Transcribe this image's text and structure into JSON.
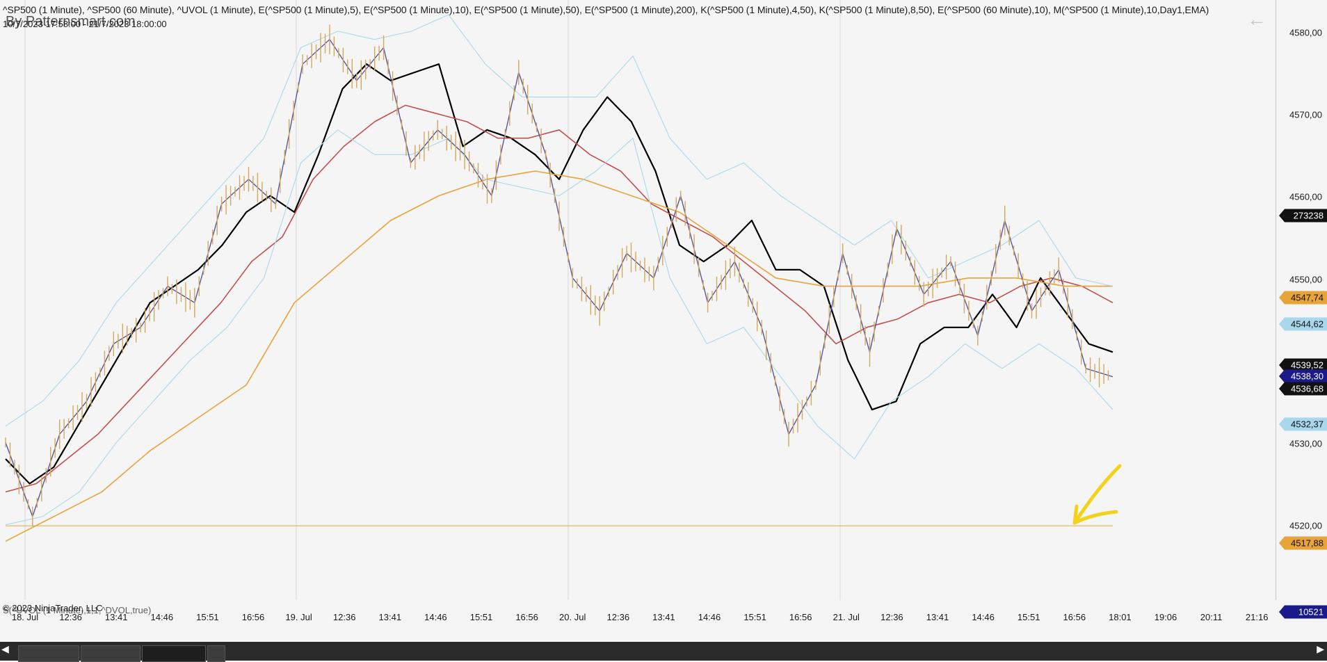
{
  "header": {
    "title": "^SP500 (1 Minute), ^SP500 (60 Minute), ^UVOL (1 Minute), E(^SP500 (1 Minute),5), E(^SP500 (1 Minute),10), E(^SP500 (1 Minute),50), E(^SP500 (1 Minute),200), K(^SP500 (1 Minute),4,50), K(^SP500 (1 Minute),8,50), E(^SP500 (60 Minute),10), M(^SP500 (1 Minute),10,Day1,EMA)",
    "subtitle": "10/7/2023 17:58:00 - 21/7/2023 18:00:00",
    "brand": "By Patternsmart.com"
  },
  "lower_panel": {
    "indicator": "S(^UVOL (1 Minute),1,1,^DVOL,true)",
    "copyright": "© 2023 NinjaTrader, LLC"
  },
  "price_axis": {
    "labels": [
      "4580,00",
      "4570,00",
      "4560,00",
      "4550,00",
      "4540,00",
      "4530,00",
      "4520,00"
    ],
    "tags": [
      {
        "value": "273238",
        "bg": "#111111",
        "fg": "#ffffff"
      },
      {
        "value": "4547,74",
        "bg": "#e8a33a",
        "fg": "#111111"
      },
      {
        "value": "4544,62",
        "bg": "#a9d8ec",
        "fg": "#111111"
      },
      {
        "value": "4539,52",
        "bg": "#111111",
        "fg": "#ffffff"
      },
      {
        "value": "4538,30",
        "bg": "#1a1a8a",
        "fg": "#ffffff"
      },
      {
        "value": "4536,68",
        "bg": "#111111",
        "fg": "#ffffff"
      },
      {
        "value": "4532,37",
        "bg": "#a9d8ec",
        "fg": "#111111"
      },
      {
        "value": "4517,88",
        "bg": "#e8a33a",
        "fg": "#111111"
      },
      {
        "value": "10521",
        "bg": "#1a1a8a",
        "fg": "#ffffff"
      }
    ]
  },
  "time_axis": {
    "labels": [
      "18. Jul",
      "12:36",
      "13:41",
      "14:46",
      "15:51",
      "16:56",
      "19. Jul",
      "12:36",
      "13:41",
      "14:46",
      "15:51",
      "16:56",
      "20. Jul",
      "12:36",
      "13:41",
      "14:46",
      "15:51",
      "16:56",
      "21. Jul",
      "12:36",
      "13:41",
      "14:46",
      "15:51",
      "16:56",
      "18:01",
      "19:06",
      "20:11",
      "21:16"
    ]
  },
  "chart_data": {
    "type": "line",
    "symbol": "^SP500",
    "y_range": [
      4512,
      4584
    ],
    "day_separators": [
      "18. Jul",
      "19. Jul",
      "20. Jul",
      "21. Jul"
    ],
    "series": [
      {
        "name": "E(^SP500 (1 Minute),10)",
        "color": "#000000",
        "values": [
          4526,
          4523,
          4525,
          4530,
          4535,
          4540,
          4545,
          4547,
          4549,
          4552,
          4556,
          4558,
          4556,
          4563,
          4571,
          4574,
          4572,
          4573,
          4574,
          4564,
          4566,
          4565,
          4563,
          4560,
          4566,
          4570,
          4567,
          4561,
          4552,
          4550,
          4552,
          4555,
          4549,
          4549,
          4547,
          4538,
          4532,
          4533,
          4540,
          4542,
          4542,
          4546,
          4542,
          4548,
          4544,
          4540,
          4539
        ]
      },
      {
        "name": "E(^SP500 (1 Minute),50)",
        "color": "#c0504d",
        "values": [
          4522,
          4523,
          4526,
          4529,
          4533,
          4537,
          4541,
          4545,
          4550,
          4553,
          4560,
          4564,
          4567,
          4569,
          4568,
          4567,
          4565,
          4565,
          4566,
          4563,
          4561,
          4557,
          4555,
          4553,
          4550,
          4547,
          4544,
          4540,
          4542,
          4543,
          4545,
          4546,
          4545,
          4547,
          4548,
          4547,
          4545
        ]
      },
      {
        "name": "E(^SP500 (1 Minute),200)",
        "color": "#e8a33a",
        "values": [
          4516,
          4519,
          4522,
          4527,
          4531,
          4535,
          4545,
          4550,
          4555,
          4558,
          4560,
          4561,
          4560,
          4558,
          4556,
          4552,
          4548,
          4547,
          4547,
          4547,
          4548,
          4548,
          4547,
          4547
        ]
      },
      {
        "name": "K upper",
        "color": "#a9d8ec",
        "values": [
          4530,
          4533,
          4538,
          4545,
          4550,
          4555,
          4560,
          4565,
          4576,
          4578,
          4577,
          4578,
          4580,
          4574,
          4570,
          4570,
          4570,
          4575,
          4565,
          4560,
          4562,
          4558,
          4555,
          4552,
          4555,
          4548,
          4550,
          4552,
          4555,
          4548,
          4547
        ]
      },
      {
        "name": "K lower",
        "color": "#a9d8ec",
        "values": [
          4518,
          4519,
          4522,
          4528,
          4533,
          4538,
          4542,
          4548,
          4562,
          4566,
          4563,
          4563,
          4565,
          4560,
          4559,
          4558,
          4561,
          4565,
          4548,
          4540,
          4542,
          4536,
          4530,
          4526,
          4533,
          4536,
          4540,
          4537,
          4540,
          4537,
          4532
        ]
      },
      {
        "name": "^SP500 (1 Minute)",
        "color": "#4b4ba0",
        "values": [
          4528,
          4519,
          4529,
          4533,
          4540,
          4542,
          4547,
          4545,
          4557,
          4560,
          4557,
          4574,
          4577,
          4572,
          4576,
          4562,
          4566,
          4563,
          4558,
          4573,
          4563,
          4548,
          4544,
          4551,
          4548,
          4558,
          4545,
          4550,
          4542,
          4529,
          4535,
          4551,
          4539,
          4554,
          4546,
          4550,
          4541,
          4555,
          4544,
          4549,
          4537,
          4536
        ]
      }
    ],
    "uvol_dvol": {
      "name": "S(^UVOL (1 Minute),1,1,^DVOL,true)",
      "last": 10521
    },
    "horizontal_line": {
      "value": 4517.88,
      "color": "#e8a33a"
    }
  },
  "footer": {
    "tabs": [
      "tab1",
      "tab2",
      "tab3",
      "tab4"
    ]
  }
}
